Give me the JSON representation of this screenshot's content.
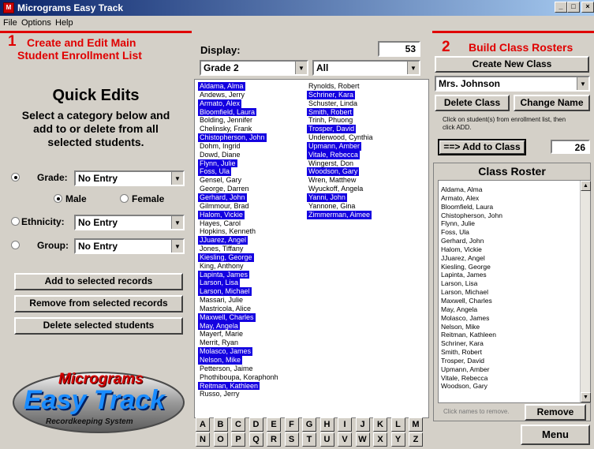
{
  "window": {
    "title": "Micrograms Easy Track",
    "app_icon_letter": "M"
  },
  "menu": [
    "File",
    "Options",
    "Help"
  ],
  "left_panel": {
    "step_number": "1",
    "heading_line1": "Create and Edit Main",
    "heading_line2": "Student Enrollment List",
    "quick_title": "Quick Edits",
    "quick_desc_line1": "Select a category below and",
    "quick_desc_line2": "add to or delete from all",
    "quick_desc_line3": "selected students.",
    "grade_label": "Grade:",
    "grade_value": "No Entry",
    "male_label": "Male",
    "female_label": "Female",
    "ethnicity_label": "Ethnicity:",
    "ethnicity_value": "No Entry",
    "group_label": "Group:",
    "group_value": "No Entry",
    "add_button": "Add to selected records",
    "remove_button": "Remove from selected records",
    "delete_button": "Delete selected students",
    "logo_line1": "Micrograms",
    "logo_line2": "Easy Track",
    "logo_line3": "Recordkeeping System"
  },
  "middle_panel": {
    "display_label": "Display:",
    "count": "53",
    "grade_filter": "Grade 2",
    "group_filter": "All",
    "students_col1": [
      {
        "name": "Aldama, Alma",
        "selected": true
      },
      {
        "name": "Andews, Jerry",
        "selected": false
      },
      {
        "name": "Armato, Alex",
        "selected": true
      },
      {
        "name": "Bloomfield, Laura",
        "selected": true
      },
      {
        "name": "Bolding, Jennifer",
        "selected": false
      },
      {
        "name": "Chelinsky, Frank",
        "selected": false
      },
      {
        "name": "Chistopherson, John",
        "selected": true
      },
      {
        "name": "Dohm, Ingrid",
        "selected": false
      },
      {
        "name": "Dowd, Diane",
        "selected": false
      },
      {
        "name": "Flynn, Julie",
        "selected": true
      },
      {
        "name": "Foss, Ula",
        "selected": true
      },
      {
        "name": "Gensel, Gary",
        "selected": false
      },
      {
        "name": "George, Darren",
        "selected": false
      },
      {
        "name": "Gerhard, John",
        "selected": true
      },
      {
        "name": "Gilmmour, Brad",
        "selected": false
      },
      {
        "name": "Halom, Vickie",
        "selected": true
      },
      {
        "name": "Hayes, Carol",
        "selected": false
      },
      {
        "name": "Hopkins, Kenneth",
        "selected": false
      },
      {
        "name": "JJuarez, Angel",
        "selected": true
      },
      {
        "name": "Jones, Tiffany",
        "selected": false
      },
      {
        "name": "Kiesling, George",
        "selected": true
      },
      {
        "name": "King, Anthony",
        "selected": false
      },
      {
        "name": "Lapinta, James",
        "selected": true
      },
      {
        "name": "Larson, Lisa",
        "selected": true
      },
      {
        "name": "Larson, Michael",
        "selected": true
      },
      {
        "name": "Massari, Julie",
        "selected": false
      },
      {
        "name": "Mastricola, Alice",
        "selected": false
      },
      {
        "name": "Maxwell, Charles",
        "selected": true
      },
      {
        "name": "May, Angela",
        "selected": true
      },
      {
        "name": "Mayerf, Marie",
        "selected": false
      },
      {
        "name": "Merrit, Ryan",
        "selected": false
      },
      {
        "name": "Molasco, James",
        "selected": true
      },
      {
        "name": "Nelson, Mike",
        "selected": true
      },
      {
        "name": "Petterson, Jaime",
        "selected": false
      },
      {
        "name": "Phothiboupa, Koraphonh",
        "selected": false
      },
      {
        "name": "Reitman, Kathleen",
        "selected": true
      },
      {
        "name": "Russo, Jerry",
        "selected": false
      }
    ],
    "students_col2": [
      {
        "name": "Rynolds, Robert",
        "selected": false
      },
      {
        "name": "Schriner, Kara",
        "selected": true
      },
      {
        "name": "Schuster, Linda",
        "selected": false
      },
      {
        "name": "Smith, Robert",
        "selected": true
      },
      {
        "name": "Trinh, Phuong",
        "selected": false
      },
      {
        "name": "Trosper, David",
        "selected": true
      },
      {
        "name": "Underwood, Cynthia",
        "selected": false
      },
      {
        "name": "Upmann, Amber",
        "selected": true
      },
      {
        "name": "Vitale, Rebecca",
        "selected": true
      },
      {
        "name": "Wingerst, Don",
        "selected": false
      },
      {
        "name": "Woodson, Gary",
        "selected": true
      },
      {
        "name": "Wren, Matthew",
        "selected": false
      },
      {
        "name": "Wyuckoff, Angela",
        "selected": false
      },
      {
        "name": "Yanni, John",
        "selected": true
      },
      {
        "name": "Yannone, Gina",
        "selected": false
      },
      {
        "name": "Zimmerman, Aimee",
        "selected": true
      }
    ],
    "alphabet_row1": [
      "A",
      "B",
      "C",
      "D",
      "E",
      "F",
      "G",
      "H",
      "I",
      "J",
      "K",
      "L",
      "M"
    ],
    "alphabet_row2": [
      "N",
      "O",
      "P",
      "Q",
      "R",
      "S",
      "T",
      "U",
      "V",
      "W",
      "X",
      "Y",
      "Z"
    ]
  },
  "right_panel": {
    "step_number": "2",
    "heading": "Build Class Rosters",
    "create_button": "Create New Class",
    "class_value": "Mrs. Johnson",
    "delete_class_button": "Delete Class",
    "change_name_button": "Change Name",
    "instruction_line1": "Click on student(s) from enrollment list, then",
    "instruction_line2": "click ADD.",
    "add_to_class_button": "==> Add to Class",
    "class_count": "26",
    "roster_title": "Class Roster",
    "roster": [
      "Aldama, Alma",
      "Armato, Alex",
      "Bloomfield, Laura",
      "Chistopherson, John",
      "Flynn, Julie",
      "Foss, Ula",
      "Gerhard, John",
      "Halom, Vickie",
      "JJuarez, Angel",
      "Kiesling, George",
      "Lapinta, James",
      "Larson, Lisa",
      "Larson, Michael",
      "Maxwell, Charles",
      "May, Angela",
      "Molasco, James",
      "Nelson, Mike",
      "Reitman, Kathleen",
      "Schriner, Kara",
      "Smith, Robert",
      "Trosper, David",
      "Upmann, Amber",
      "Vitale, Rebecca",
      "Woodson, Gary"
    ],
    "remove_hint": "Click names to remove.",
    "remove_button": "Remove",
    "menu_button": "Menu"
  }
}
